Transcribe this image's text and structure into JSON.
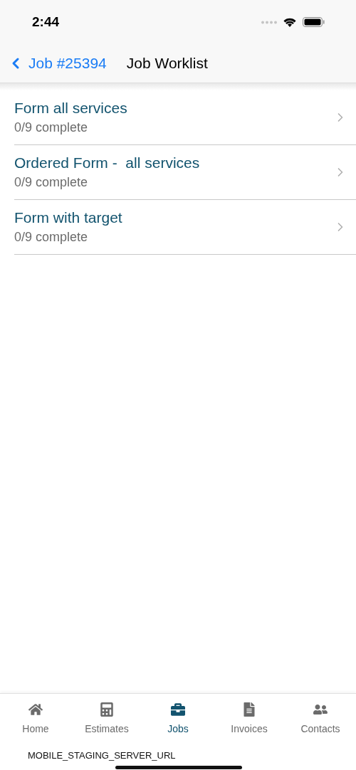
{
  "status_bar": {
    "time": "2:44"
  },
  "nav_bar": {
    "back_label": "Job #25394",
    "title": "Job Worklist"
  },
  "worklist": [
    {
      "title": "Form all services",
      "subtitle": "0/9 complete"
    },
    {
      "title": "Ordered Form -  all services",
      "subtitle": "0/9 complete"
    },
    {
      "title": "Form with target",
      "subtitle": "0/9 complete"
    }
  ],
  "tab_bar": [
    {
      "label": "Home",
      "kind": "home",
      "selected": false
    },
    {
      "label": "Estimates",
      "kind": "calculator",
      "selected": false
    },
    {
      "label": "Jobs",
      "kind": "briefcase",
      "selected": true
    },
    {
      "label": "Invoices",
      "kind": "document",
      "selected": false
    },
    {
      "label": "Contacts",
      "kind": "people",
      "selected": false
    }
  ],
  "footer_note": "MOBILE_STAGING_SERVER_URL"
}
